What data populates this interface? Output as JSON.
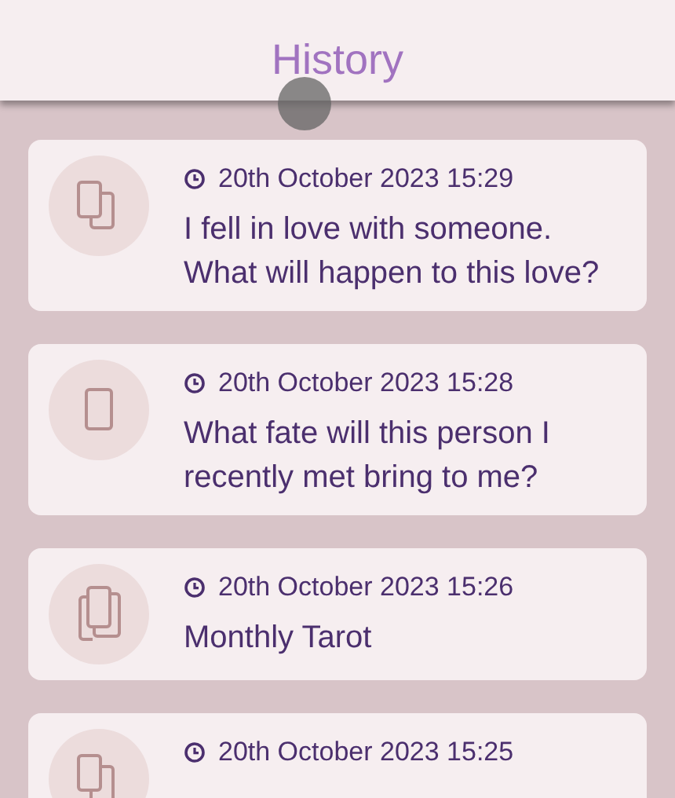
{
  "header": {
    "title": "History"
  },
  "entries": [
    {
      "kind": "double",
      "date": "20th October 2023 15:29",
      "question": "I fell in love with someone. What will happen to this love?"
    },
    {
      "kind": "single",
      "date": "20th October 2023 15:28",
      "question": "What fate will this person I recently met bring to me?"
    },
    {
      "kind": "triple",
      "date": "20th October 2023 15:26",
      "question": "Monthly Tarot"
    },
    {
      "kind": "double",
      "date": "20th October 2023 15:25"
    }
  ]
}
